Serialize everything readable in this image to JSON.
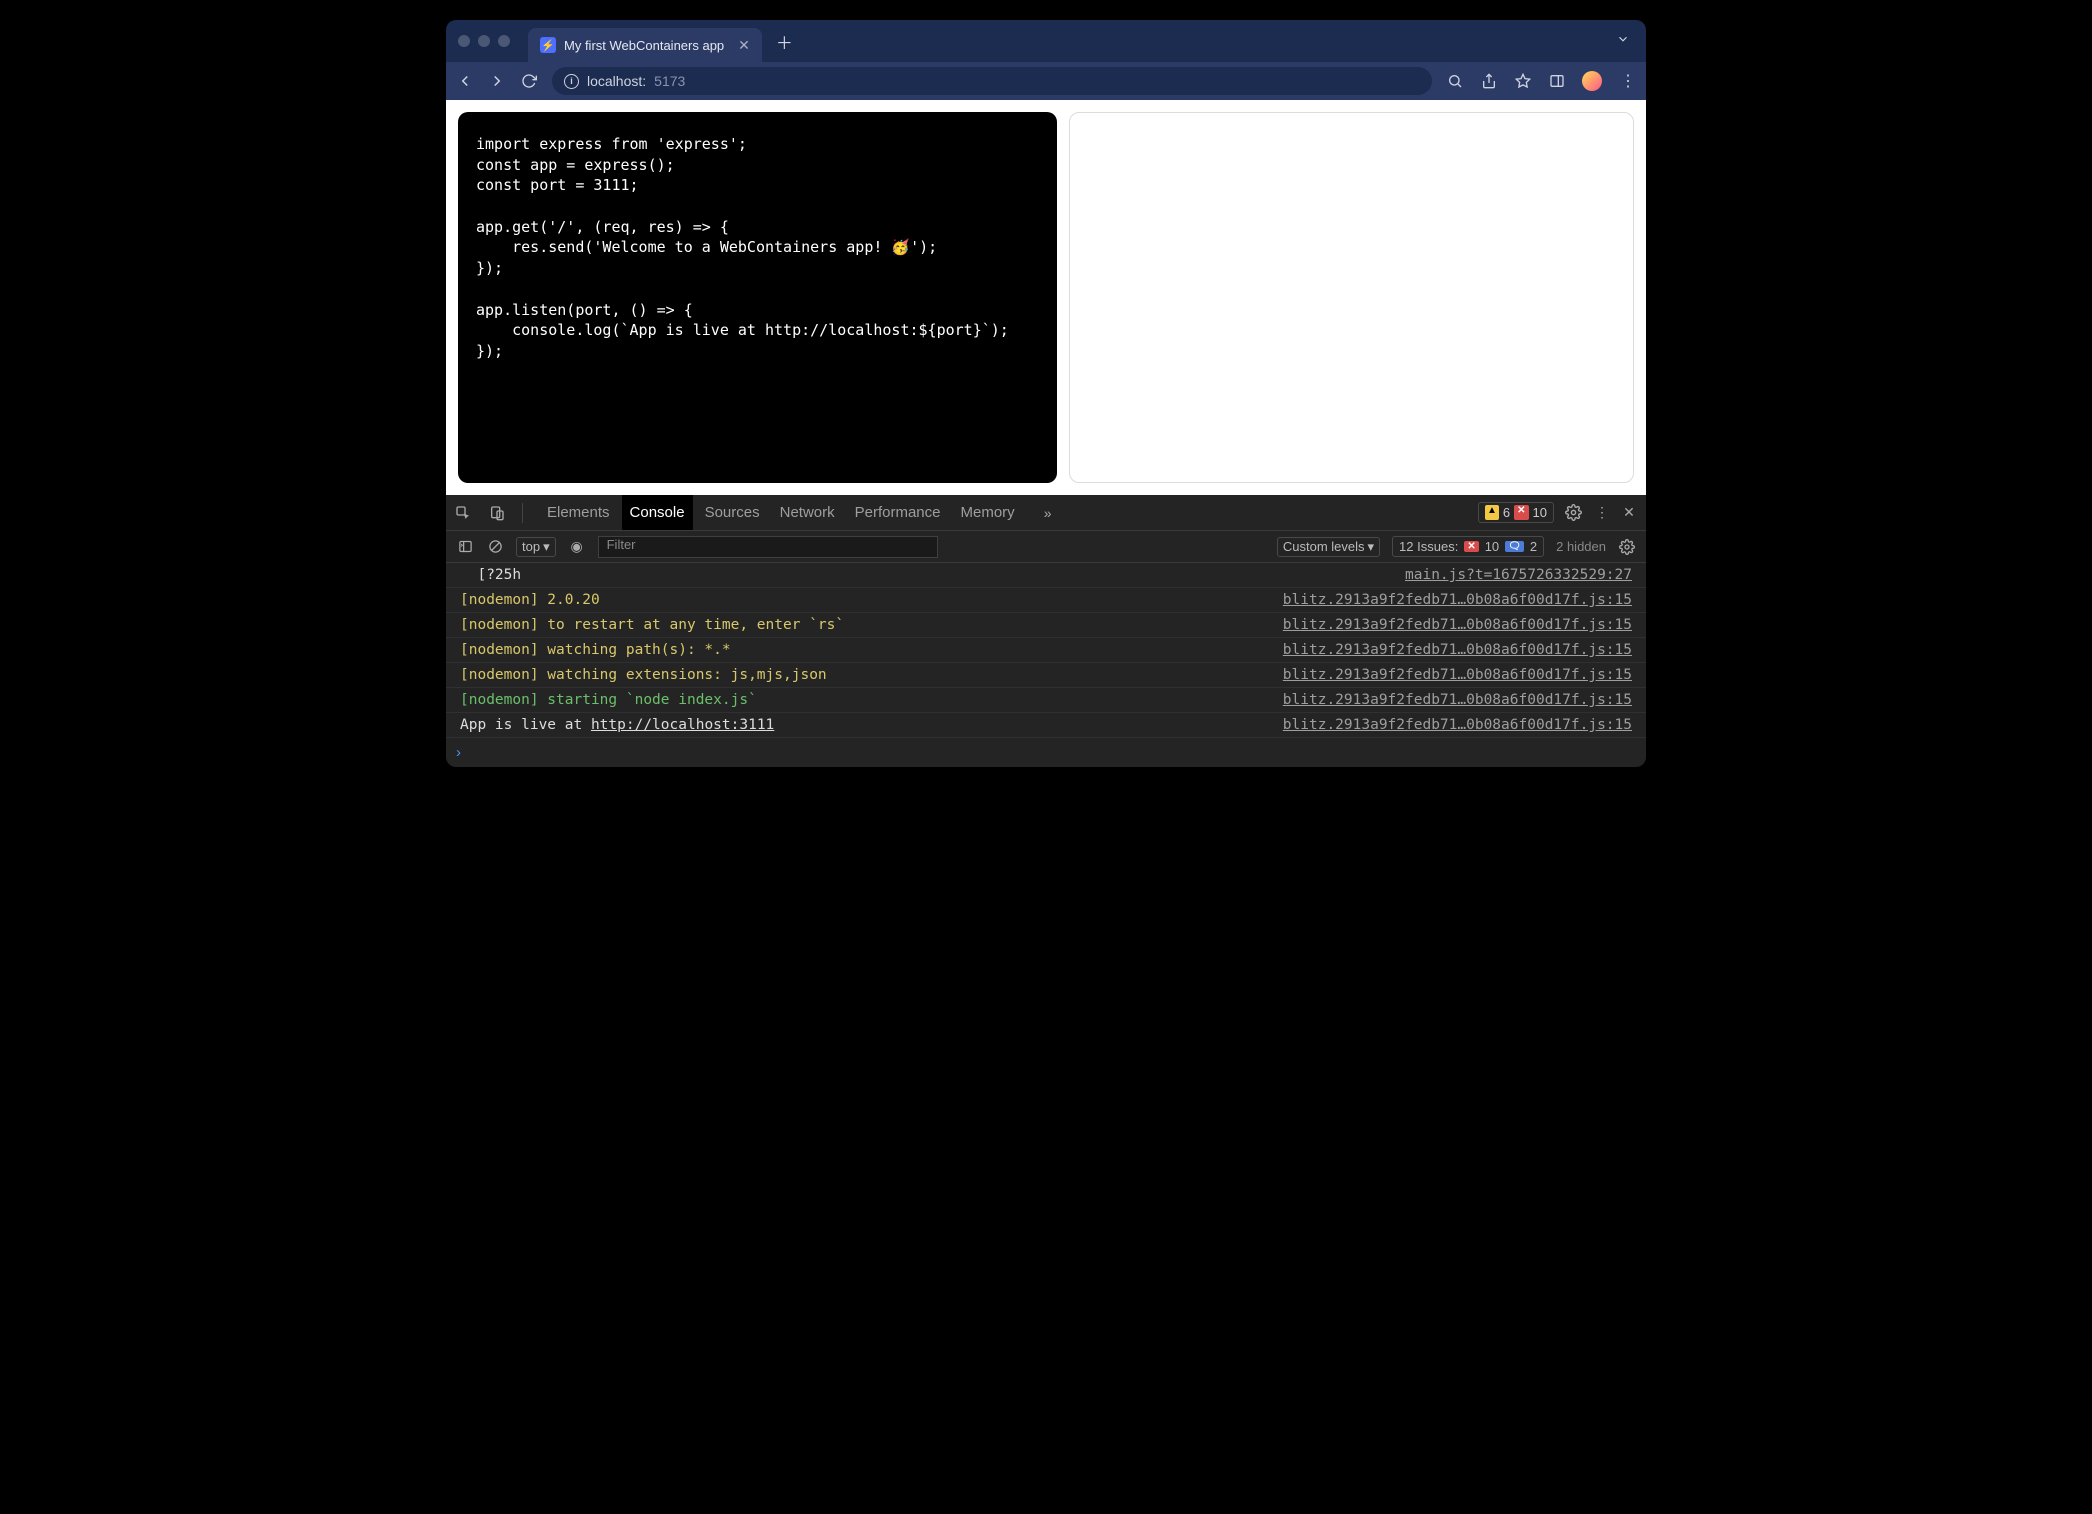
{
  "tab": {
    "title": "My first WebContainers app"
  },
  "url": {
    "host": "localhost:",
    "port": "5173"
  },
  "code": "import express from 'express';\nconst app = express();\nconst port = 3111;\n\napp.get('/', (req, res) => {\n    res.send('Welcome to a WebContainers app! 🥳');\n});\n\napp.listen(port, () => {\n    console.log(`App is live at http://localhost:${port}`);\n});",
  "devtools": {
    "tabs": [
      "Elements",
      "Console",
      "Sources",
      "Network",
      "Performance",
      "Memory"
    ],
    "active": "Console",
    "warnings": "6",
    "errors": "10",
    "toolbar": {
      "context": "top",
      "filter_placeholder": "Filter",
      "levels": "Custom levels",
      "issues_label": "12 Issues:",
      "issues_err": "10",
      "issues_info": "2",
      "hidden": "2 hidden"
    },
    "logs": [
      {
        "cls": "c-white",
        "msg": "  [?25h",
        "src": "main.js?t=1675726332529:27"
      },
      {
        "cls": "c-yellow",
        "msg": "[nodemon] 2.0.20",
        "src": "blitz.2913a9f2fedb71…0b08a6f00d17f.js:15"
      },
      {
        "cls": "c-yellow",
        "msg": "[nodemon] to restart at any time, enter `rs`",
        "src": "blitz.2913a9f2fedb71…0b08a6f00d17f.js:15"
      },
      {
        "cls": "c-yellow",
        "msg": "[nodemon] watching path(s): *.*",
        "src": "blitz.2913a9f2fedb71…0b08a6f00d17f.js:15"
      },
      {
        "cls": "c-yellow",
        "msg": "[nodemon] watching extensions: js,mjs,json",
        "src": "blitz.2913a9f2fedb71…0b08a6f00d17f.js:15"
      },
      {
        "cls": "c-green",
        "msg": "[nodemon] starting `node index.js`",
        "src": "blitz.2913a9f2fedb71…0b08a6f00d17f.js:15"
      },
      {
        "cls": "c-white",
        "msg": "App is live at ",
        "link": "http://localhost:3111",
        "src": "blitz.2913a9f2fedb71…0b08a6f00d17f.js:15"
      }
    ]
  }
}
